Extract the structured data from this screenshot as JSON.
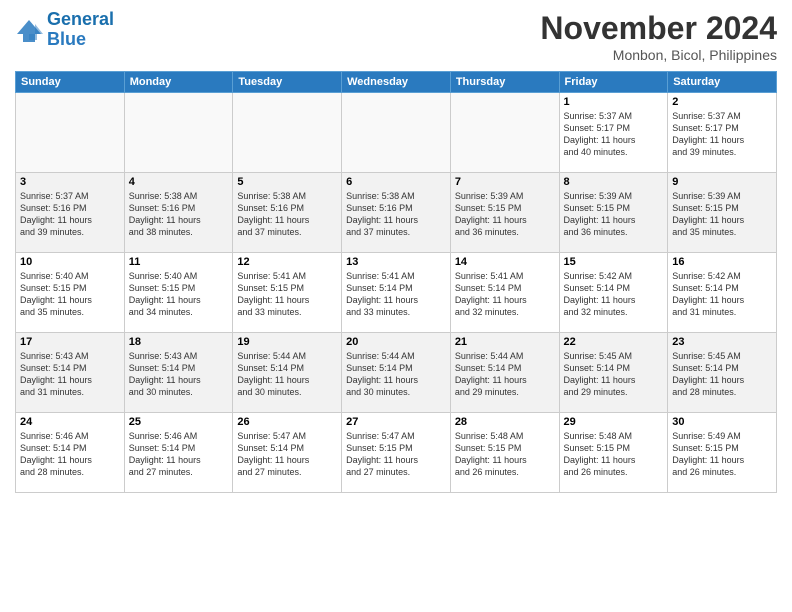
{
  "header": {
    "logo_line1": "General",
    "logo_line2": "Blue",
    "month": "November 2024",
    "location": "Monbon, Bicol, Philippines"
  },
  "weekdays": [
    "Sunday",
    "Monday",
    "Tuesday",
    "Wednesday",
    "Thursday",
    "Friday",
    "Saturday"
  ],
  "weeks": [
    [
      {
        "day": "",
        "info": ""
      },
      {
        "day": "",
        "info": ""
      },
      {
        "day": "",
        "info": ""
      },
      {
        "day": "",
        "info": ""
      },
      {
        "day": "",
        "info": ""
      },
      {
        "day": "1",
        "info": "Sunrise: 5:37 AM\nSunset: 5:17 PM\nDaylight: 11 hours\nand 40 minutes."
      },
      {
        "day": "2",
        "info": "Sunrise: 5:37 AM\nSunset: 5:17 PM\nDaylight: 11 hours\nand 39 minutes."
      }
    ],
    [
      {
        "day": "3",
        "info": "Sunrise: 5:37 AM\nSunset: 5:16 PM\nDaylight: 11 hours\nand 39 minutes."
      },
      {
        "day": "4",
        "info": "Sunrise: 5:38 AM\nSunset: 5:16 PM\nDaylight: 11 hours\nand 38 minutes."
      },
      {
        "day": "5",
        "info": "Sunrise: 5:38 AM\nSunset: 5:16 PM\nDaylight: 11 hours\nand 37 minutes."
      },
      {
        "day": "6",
        "info": "Sunrise: 5:38 AM\nSunset: 5:16 PM\nDaylight: 11 hours\nand 37 minutes."
      },
      {
        "day": "7",
        "info": "Sunrise: 5:39 AM\nSunset: 5:15 PM\nDaylight: 11 hours\nand 36 minutes."
      },
      {
        "day": "8",
        "info": "Sunrise: 5:39 AM\nSunset: 5:15 PM\nDaylight: 11 hours\nand 36 minutes."
      },
      {
        "day": "9",
        "info": "Sunrise: 5:39 AM\nSunset: 5:15 PM\nDaylight: 11 hours\nand 35 minutes."
      }
    ],
    [
      {
        "day": "10",
        "info": "Sunrise: 5:40 AM\nSunset: 5:15 PM\nDaylight: 11 hours\nand 35 minutes."
      },
      {
        "day": "11",
        "info": "Sunrise: 5:40 AM\nSunset: 5:15 PM\nDaylight: 11 hours\nand 34 minutes."
      },
      {
        "day": "12",
        "info": "Sunrise: 5:41 AM\nSunset: 5:15 PM\nDaylight: 11 hours\nand 33 minutes."
      },
      {
        "day": "13",
        "info": "Sunrise: 5:41 AM\nSunset: 5:14 PM\nDaylight: 11 hours\nand 33 minutes."
      },
      {
        "day": "14",
        "info": "Sunrise: 5:41 AM\nSunset: 5:14 PM\nDaylight: 11 hours\nand 32 minutes."
      },
      {
        "day": "15",
        "info": "Sunrise: 5:42 AM\nSunset: 5:14 PM\nDaylight: 11 hours\nand 32 minutes."
      },
      {
        "day": "16",
        "info": "Sunrise: 5:42 AM\nSunset: 5:14 PM\nDaylight: 11 hours\nand 31 minutes."
      }
    ],
    [
      {
        "day": "17",
        "info": "Sunrise: 5:43 AM\nSunset: 5:14 PM\nDaylight: 11 hours\nand 31 minutes."
      },
      {
        "day": "18",
        "info": "Sunrise: 5:43 AM\nSunset: 5:14 PM\nDaylight: 11 hours\nand 30 minutes."
      },
      {
        "day": "19",
        "info": "Sunrise: 5:44 AM\nSunset: 5:14 PM\nDaylight: 11 hours\nand 30 minutes."
      },
      {
        "day": "20",
        "info": "Sunrise: 5:44 AM\nSunset: 5:14 PM\nDaylight: 11 hours\nand 30 minutes."
      },
      {
        "day": "21",
        "info": "Sunrise: 5:44 AM\nSunset: 5:14 PM\nDaylight: 11 hours\nand 29 minutes."
      },
      {
        "day": "22",
        "info": "Sunrise: 5:45 AM\nSunset: 5:14 PM\nDaylight: 11 hours\nand 29 minutes."
      },
      {
        "day": "23",
        "info": "Sunrise: 5:45 AM\nSunset: 5:14 PM\nDaylight: 11 hours\nand 28 minutes."
      }
    ],
    [
      {
        "day": "24",
        "info": "Sunrise: 5:46 AM\nSunset: 5:14 PM\nDaylight: 11 hours\nand 28 minutes."
      },
      {
        "day": "25",
        "info": "Sunrise: 5:46 AM\nSunset: 5:14 PM\nDaylight: 11 hours\nand 27 minutes."
      },
      {
        "day": "26",
        "info": "Sunrise: 5:47 AM\nSunset: 5:14 PM\nDaylight: 11 hours\nand 27 minutes."
      },
      {
        "day": "27",
        "info": "Sunrise: 5:47 AM\nSunset: 5:15 PM\nDaylight: 11 hours\nand 27 minutes."
      },
      {
        "day": "28",
        "info": "Sunrise: 5:48 AM\nSunset: 5:15 PM\nDaylight: 11 hours\nand 26 minutes."
      },
      {
        "day": "29",
        "info": "Sunrise: 5:48 AM\nSunset: 5:15 PM\nDaylight: 11 hours\nand 26 minutes."
      },
      {
        "day": "30",
        "info": "Sunrise: 5:49 AM\nSunset: 5:15 PM\nDaylight: 11 hours\nand 26 minutes."
      }
    ]
  ]
}
